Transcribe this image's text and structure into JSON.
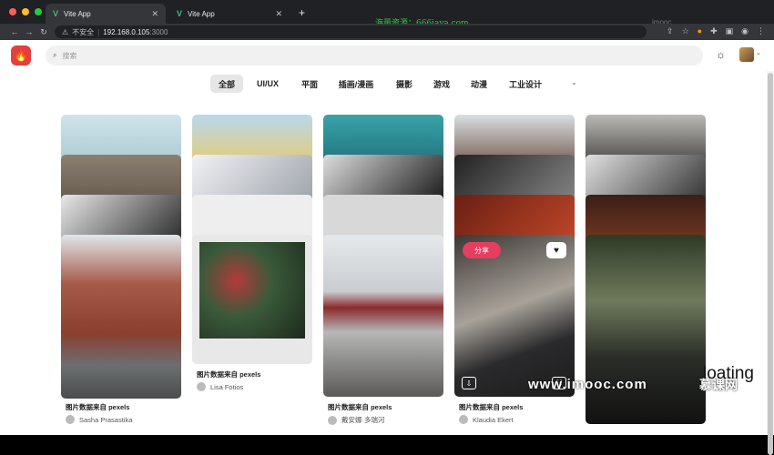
{
  "browser": {
    "tabs": [
      {
        "title": "Vite App",
        "active": true
      },
      {
        "title": "Vite App",
        "active": false
      }
    ],
    "watermark_top": "海量资源：666java.com",
    "imooc_top": "imooc",
    "url": {
      "security": "不安全",
      "host": "192.168.0.105",
      "port": ":3000"
    },
    "colors": {
      "close": "#ff5f57",
      "minimize": "#febc2e",
      "maximize": "#28c840"
    }
  },
  "header": {
    "search_placeholder": "搜索",
    "logo_icon": "flame-icon",
    "theme_icon": "sun-icon"
  },
  "categories": [
    "全部",
    "UI/UX",
    "平面",
    "插画/漫画",
    "摄影",
    "游戏",
    "动漫",
    "工业设计"
  ],
  "selected_category": "全部",
  "cards": [
    {
      "caption": "图片数据来自 pexels",
      "author": "Sasha Prasastika"
    },
    {
      "caption": "图片数据来自 pexels",
      "author": "Lisa Fotios"
    },
    {
      "caption": "图片数据来自 pexels",
      "author": "戴安娜·多瑞河"
    },
    {
      "caption": "图片数据来自 pexels",
      "author": "Klaudia Ekert"
    }
  ],
  "overlay": {
    "share_label": "分享"
  },
  "floating_text": "loating",
  "watermark_bottom": "www.imooc.com",
  "watermark_brand": "慕课网"
}
